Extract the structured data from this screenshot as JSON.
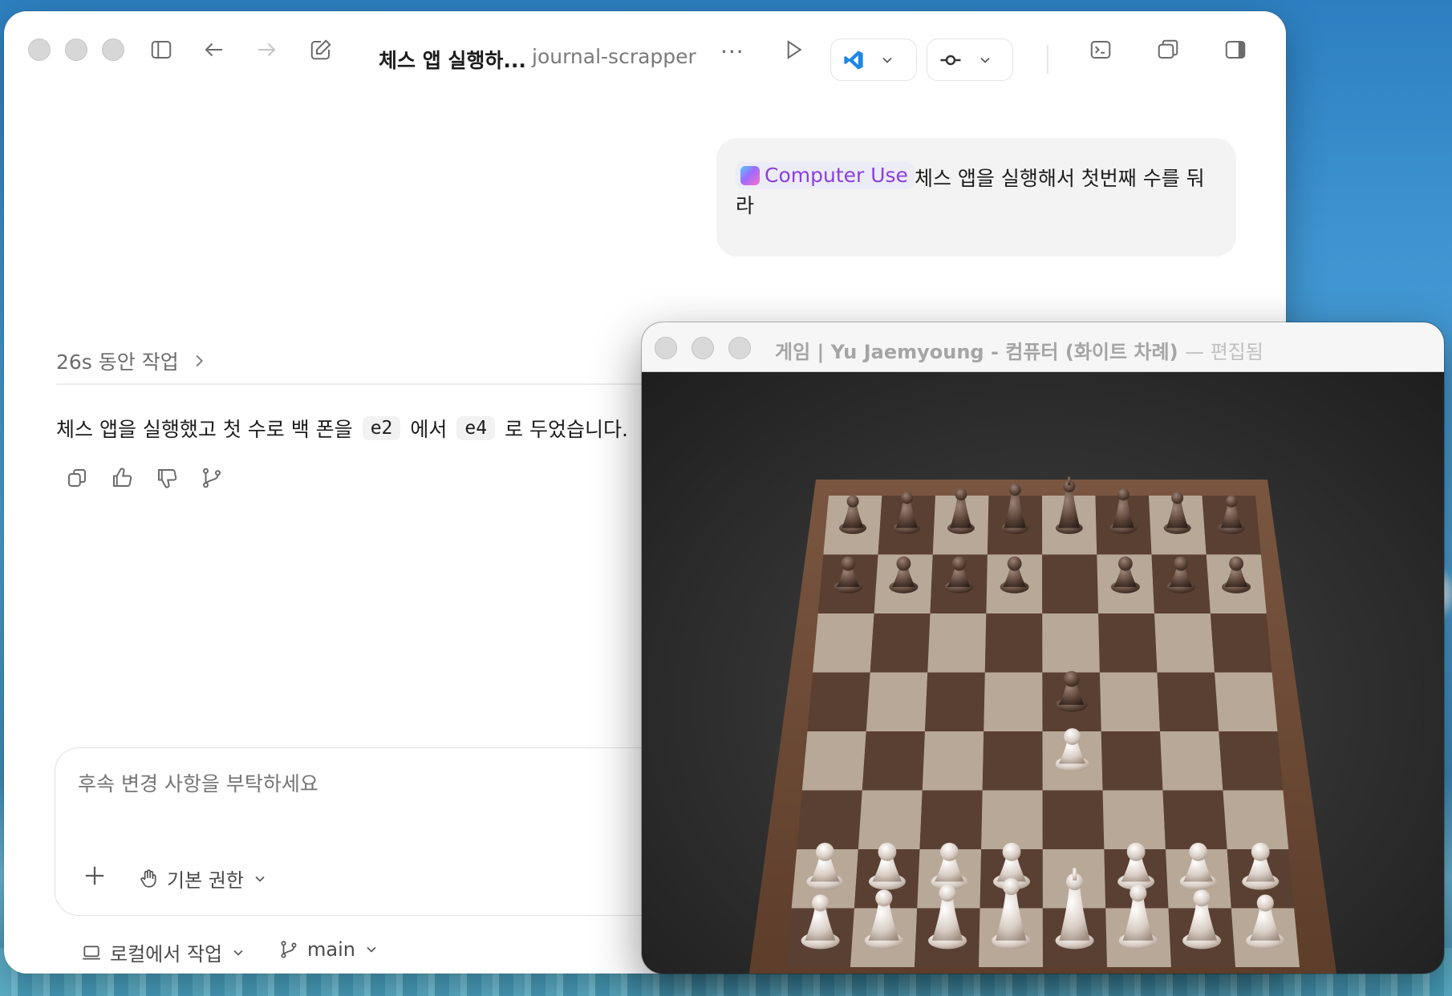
{
  "app": {
    "title": "체스 앱 실행하...",
    "project": "journal-scrapper",
    "more": "···"
  },
  "chat": {
    "user_chip": "Computer Use",
    "user_message": "체스 앱을 실행해서 첫번째 수를 둬라",
    "work_summary": "26s 동안 작업",
    "answer_parts": {
      "a": "체스 앱을 실행했고 첫 수로 백 폰을",
      "code1": "e2",
      "b": "에서",
      "code2": "e4",
      "c": "로 두었습니다."
    }
  },
  "composer": {
    "placeholder": "후속 변경 사항을 부탁하세요",
    "permission": "기본 권한"
  },
  "footer": {
    "location": "로컬에서 작업",
    "branch": "main"
  },
  "chess_window": {
    "title": "게임 | Yu Jaemyoung - 컴퓨터   (화이트 차례)",
    "edited": "— 편집됨",
    "position": {
      "black": [
        "a8 rook",
        "b8 knight",
        "c8 bishop",
        "d8 queen",
        "e8 king",
        "f8 bishop",
        "g8 knight",
        "h8 rook",
        "a7",
        "b7",
        "c7",
        "d7",
        "e5",
        "f7",
        "g7",
        "h7"
      ],
      "white": [
        "e4",
        "a2",
        "b2",
        "c2",
        "d2",
        "f2",
        "g2",
        "h2",
        "a1 rook",
        "b1 knight",
        "c1 bishop",
        "d1 queen",
        "e1 king",
        "f1 bishop",
        "g1 knight",
        "h1 rook"
      ]
    }
  },
  "colors": {
    "accent": "#8b3fe0",
    "vscode": "#1e88e5"
  }
}
